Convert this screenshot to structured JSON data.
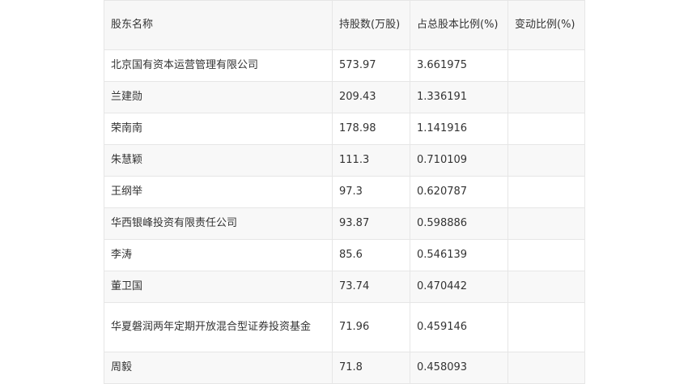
{
  "table": {
    "headers": {
      "name": "股东名称",
      "shares": "持股数(万股)",
      "ratio": "占总股本比例(%)",
      "change": "变动比例(%)"
    },
    "rows": [
      {
        "name": "北京国有资本运营管理有限公司",
        "shares": "573.97",
        "ratio": "3.661975",
        "change": ""
      },
      {
        "name": "兰建勋",
        "shares": "209.43",
        "ratio": "1.336191",
        "change": ""
      },
      {
        "name": "荣南南",
        "shares": "178.98",
        "ratio": "1.141916",
        "change": ""
      },
      {
        "name": "朱慧颖",
        "shares": "111.3",
        "ratio": "0.710109",
        "change": ""
      },
      {
        "name": "王纲举",
        "shares": "97.3",
        "ratio": "0.620787",
        "change": ""
      },
      {
        "name": "华西银峰投资有限责任公司",
        "shares": "93.87",
        "ratio": "0.598886",
        "change": ""
      },
      {
        "name": "李涛",
        "shares": "85.6",
        "ratio": "0.546139",
        "change": ""
      },
      {
        "name": "董卫国",
        "shares": "73.74",
        "ratio": "0.470442",
        "change": ""
      },
      {
        "name": "华夏磐润两年定期开放混合型证券投资基金",
        "shares": "71.96",
        "ratio": "0.459146",
        "change": ""
      },
      {
        "name": "周毅",
        "shares": "71.8",
        "ratio": "0.458093",
        "change": ""
      }
    ]
  }
}
